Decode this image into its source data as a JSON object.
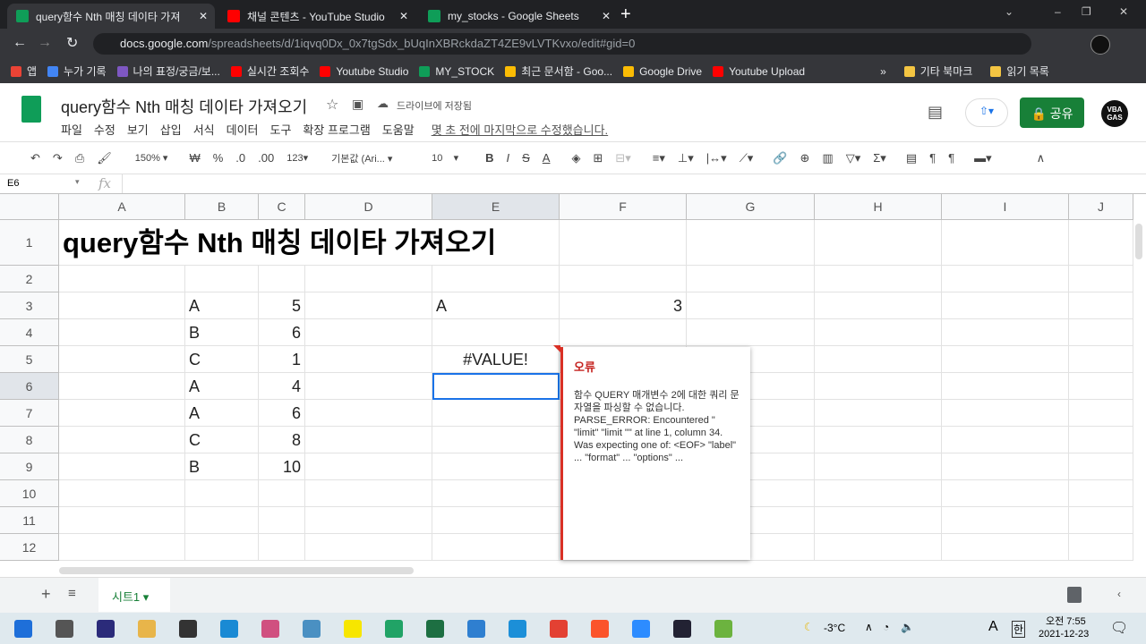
{
  "browser": {
    "tabs": [
      {
        "title": "query함수 Nth 매칭 데이타 가져",
        "color": "#0f9d58",
        "active": true
      },
      {
        "title": "채널 콘텐츠 - YouTube Studio",
        "color": "#ff0000"
      },
      {
        "title": "my_stocks - Google Sheets",
        "color": "#0f9d58"
      }
    ],
    "url_host": "docs.google.com",
    "url_path": "/spreadsheets/d/1iqvq0Dx_0x7tgSdx_bUqInXBRckdaZT4ZE9vLVTKvxo/edit#gid=0",
    "bookmarks": [
      {
        "label": "앱",
        "color": "#ea4335"
      },
      {
        "label": "누가 기록",
        "color": "#4285f4"
      },
      {
        "label": "나의 표정/궁금/보...",
        "color": "#7e57c2"
      },
      {
        "label": "실시간 조회수",
        "color": "#ff0000"
      },
      {
        "label": "Youtube Studio",
        "color": "#ff0000"
      },
      {
        "label": "MY_STOCK",
        "color": "#0f9d58"
      },
      {
        "label": "최근 문서함 - Goo...",
        "color": "#fbbc04"
      },
      {
        "label": "Google Drive",
        "color": "#fbbc04"
      },
      {
        "label": "Youtube Upload",
        "color": "#ff0000"
      }
    ],
    "bookmarks_right": [
      "기타 북마크",
      "읽기 목록"
    ]
  },
  "doc": {
    "title": "query함수 Nth 매칭 데이타 가져오기",
    "saved": "드라이브에 저장됨",
    "menus": [
      "파일",
      "수정",
      "보기",
      "삽입",
      "서식",
      "데이터",
      "도구",
      "확장 프로그램",
      "도움말"
    ],
    "last_edit": "몇 초 전에 마지막으로 수정했습니다.",
    "share": "공유",
    "avatar": "VBA GAS"
  },
  "toolbar": {
    "zoom": "150%",
    "currency": "₩",
    "percent": "%",
    "dec_less": ".0",
    "dec_more": ".00",
    "format": "123",
    "font": "기본값 (Ari...",
    "size": "10"
  },
  "formula_bar": {
    "cell_ref": "E6",
    "fx": "fx"
  },
  "columns": [
    "A",
    "B",
    "C",
    "D",
    "E",
    "F",
    "G",
    "H",
    "I",
    "J"
  ],
  "rows": [
    "1",
    "2",
    "3",
    "4",
    "5",
    "6",
    "7",
    "8",
    "9",
    "10",
    "11",
    "12"
  ],
  "cells": {
    "title": "query함수 Nth 매칭 데이타 가져오기",
    "B": [
      "A",
      "B",
      "C",
      "A",
      "A",
      "C",
      "B"
    ],
    "C": [
      "5",
      "6",
      "1",
      "4",
      "6",
      "8",
      "10"
    ],
    "E3": "A",
    "F3": "3",
    "E5": "#VALUE!"
  },
  "error_popup": {
    "title": "오류",
    "message": "함수 QUERY 매개변수 2에 대한 쿼리 문자열을 파싱할 수 없습니다. PARSE_ERROR: Encountered \" \"limit\" \"limit \"\" at line 1, column 34. Was expecting one of: <EOF> \"label\" ... \"format\" ... \"options\" ..."
  },
  "sheet": {
    "tab": "시트1"
  },
  "taskbar": {
    "temp": "-3°C",
    "lang": "A",
    "ime": "한",
    "time": "오전 7:55",
    "date": "2021-12-23"
  }
}
